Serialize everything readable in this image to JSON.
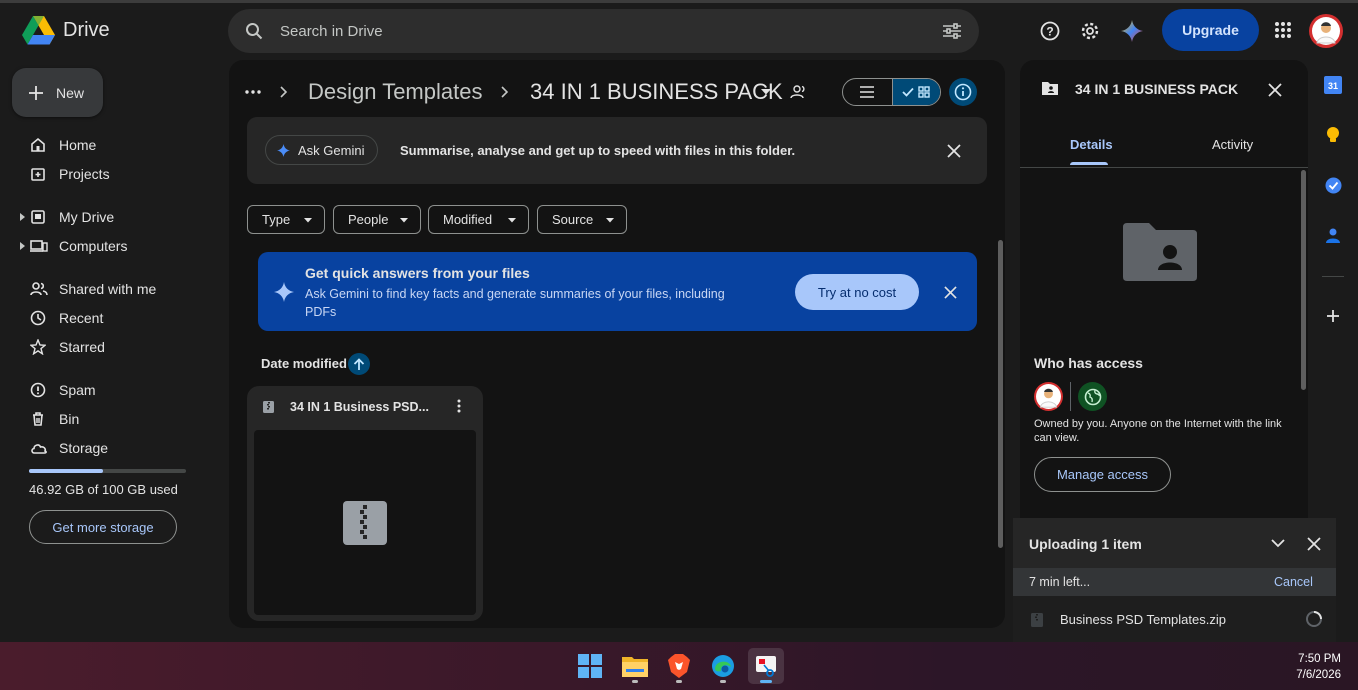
{
  "app": {
    "name": "Drive"
  },
  "search": {
    "placeholder": "Search in Drive"
  },
  "header": {
    "upgrade_label": "Upgrade"
  },
  "sidebar": {
    "new_label": "New",
    "items": [
      {
        "label": "Home",
        "icon": "home-icon"
      },
      {
        "label": "Projects",
        "icon": "projects-icon"
      },
      {
        "label": "My Drive",
        "icon": "my-drive-icon"
      },
      {
        "label": "Computers",
        "icon": "computers-icon"
      },
      {
        "label": "Shared with me",
        "icon": "shared-icon"
      },
      {
        "label": "Recent",
        "icon": "clock-icon"
      },
      {
        "label": "Starred",
        "icon": "star-icon"
      },
      {
        "label": "Spam",
        "icon": "spam-icon"
      },
      {
        "label": "Bin",
        "icon": "bin-icon"
      },
      {
        "label": "Storage",
        "icon": "cloud-icon"
      }
    ],
    "storage_text": "46.92 GB of 100 GB used",
    "storage_used_fraction": 0.4692,
    "get_more_label": "Get more storage"
  },
  "breadcrumb": {
    "parent": "Design Templates",
    "current": "34 IN 1 BUSINESS PACK"
  },
  "gemini_bar": {
    "button_label": "Ask Gemini",
    "text": "Summarise, analyse and get up to speed with files in this folder."
  },
  "filters": [
    "Type",
    "People",
    "Modified",
    "Source"
  ],
  "promo": {
    "title": "Get quick answers from your files",
    "body": "Ask Gemini to find key facts and generate summaries of your files, including PDFs",
    "cta": "Try at no cost"
  },
  "sort": {
    "label": "Date modified"
  },
  "files": [
    {
      "name": "34 IN 1 Business PSD..."
    }
  ],
  "details": {
    "title": "34 IN 1 BUSINESS PACK",
    "tabs": [
      "Details",
      "Activity"
    ],
    "who_has_access": "Who has access",
    "owned_text": "Owned by you. Anyone on the Internet with the link can view.",
    "manage_label": "Manage access"
  },
  "upload": {
    "title": "Uploading 1 item",
    "time_left": "7 min left...",
    "cancel_label": "Cancel",
    "file_name": "Business PSD Templates.zip"
  },
  "rail": {
    "calendar_day": "31"
  },
  "clock": {
    "time": "7:50 PM",
    "date": "7/6/2026"
  },
  "colors": {
    "accent": "#a8c7fa",
    "primary_button": "#0842a0",
    "background": "#1b1b1b"
  }
}
